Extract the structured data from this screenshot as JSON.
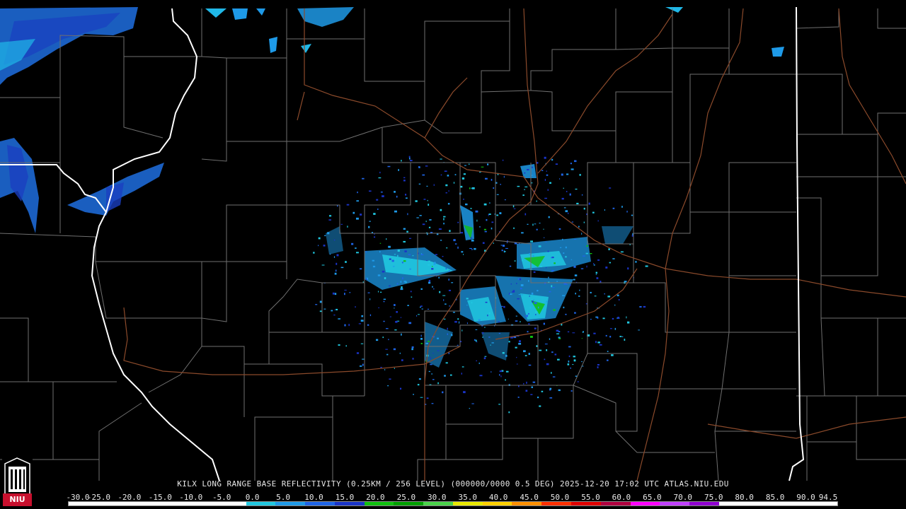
{
  "product": {
    "caption": "KILX LONG RANGE BASE REFLECTIVITY (0.25KM / 256 LEVEL) (000000/0000 0.5 DEG) 2025-12-20 17:02 UTC  ATLAS.NIU.EDU",
    "station": "KILX",
    "timestamp": "2025-12-20 17:02 UTC",
    "source": "ATLAS.NIU.EDU"
  },
  "logo": {
    "text": "NIU",
    "icon": "university-seal-icon",
    "color": "#c8102e"
  },
  "colors": {
    "background": "#000000",
    "county_lines": "#6f6f6f",
    "state_lines": "#ffffff",
    "highways": "#8b4a2b"
  },
  "scale": {
    "labels": [
      "-30.0",
      "-25.0",
      "-20.0",
      "-15.0",
      "-10.0",
      "-5.0",
      "0.0",
      "5.0",
      "10.0",
      "15.0",
      "20.0",
      "25.0",
      "30.0",
      "35.0",
      "40.0",
      "45.0",
      "50.0",
      "55.0",
      "60.0",
      "65.0",
      "70.0",
      "75.0",
      "80.0",
      "85.0",
      "90.0",
      "94.5"
    ],
    "colors": [
      "#ffffff",
      "#ffffff",
      "#ffffff",
      "#ffffff",
      "#ffffff",
      "#ffffff",
      "#20c8e0",
      "#1e9ae8",
      "#1e64e6",
      "#1a34c8",
      "#10c010",
      "#00a000",
      "#4ad24a",
      "#e8e800",
      "#ffd000",
      "#ff9000",
      "#ff3000",
      "#e00000",
      "#b00040",
      "#ff00ff",
      "#c040ff",
      "#9000d0",
      "#ffffff",
      "#ffffff",
      "#ffffff",
      "#ffffff"
    ]
  }
}
